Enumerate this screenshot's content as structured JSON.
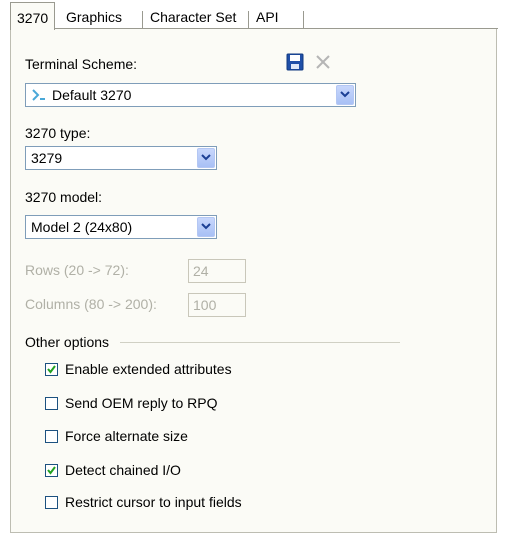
{
  "tabs": [
    {
      "label": "3270",
      "active": true
    },
    {
      "label": "Graphics",
      "active": false
    },
    {
      "label": "Character Set",
      "active": false
    },
    {
      "label": "API",
      "active": false
    }
  ],
  "terminal_scheme": {
    "label": "Terminal Scheme:",
    "value": "Default 3270"
  },
  "type": {
    "label": "3270 type:",
    "value": "3279"
  },
  "model": {
    "label": "3270 model:",
    "value": "Model 2 (24x80)"
  },
  "rows": {
    "label": "Rows (20 -> 72):",
    "value": "24"
  },
  "columns": {
    "label": "Columns (80 -> 200):",
    "value": "100"
  },
  "other_options": {
    "label": "Other options",
    "items": [
      {
        "label": "Enable extended attributes",
        "checked": true
      },
      {
        "label": "Send OEM reply to RPQ",
        "checked": false
      },
      {
        "label": "Force alternate size",
        "checked": false
      },
      {
        "label": "Detect chained I/O",
        "checked": true
      },
      {
        "label": "Restrict cursor to input fields",
        "checked": false
      }
    ]
  },
  "colors": {
    "panel_bg": "#fbfbf6",
    "combo_border": "#7f9db9",
    "check_green": "#21a121",
    "disabled_text": "#b0b0a6"
  },
  "icons": [
    "save-icon",
    "delete-icon",
    "scheme-icon",
    "chevron-down-icon"
  ]
}
